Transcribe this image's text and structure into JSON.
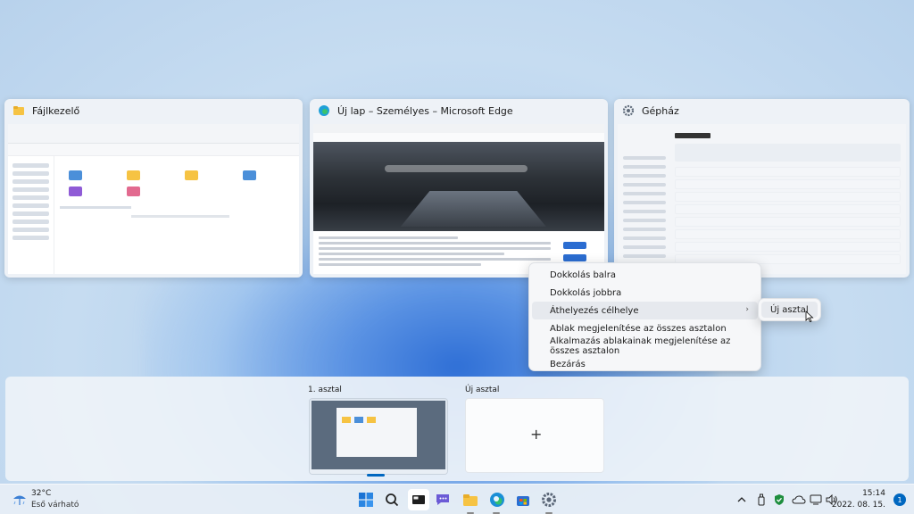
{
  "windows": [
    {
      "title": "Fájlkezelő",
      "icon": "folder-icon"
    },
    {
      "title": "Új lap – Személyes – Microsoft Edge",
      "icon": "edge-icon"
    },
    {
      "title": "Gépház",
      "icon": "gear-icon"
    }
  ],
  "context_menu": {
    "items": [
      {
        "label": "Dokkolás balra"
      },
      {
        "label": "Dokkolás jobbra"
      },
      {
        "label": "Áthelyezés célhelye",
        "has_submenu": true
      },
      {
        "label": "Ablak megjelenítése az összes asztalon"
      },
      {
        "label": "Alkalmazás ablakainak megjelenítése az összes asztalon"
      },
      {
        "label": "Bezárás"
      }
    ]
  },
  "submenu": {
    "items": [
      {
        "label": "Új asztal"
      }
    ]
  },
  "desktops": [
    {
      "label": "1. asztal"
    },
    {
      "label": "Új asztal",
      "add_glyph": "+"
    }
  ],
  "weather": {
    "temp": "32°C",
    "condition": "Eső várható"
  },
  "clock": {
    "time": "15:14",
    "date": "2022. 08. 15."
  },
  "notifications": {
    "count": "1"
  },
  "colors": {
    "accent": "#0067c0",
    "folder": "#f6c343"
  }
}
